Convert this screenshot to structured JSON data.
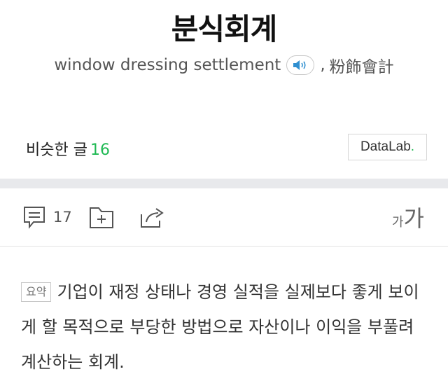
{
  "entry": {
    "title": "분식회계",
    "english": "window dressing settlement",
    "separator": ",",
    "hanja": "粉飾會計"
  },
  "icons": {
    "speaker": "speaker-icon",
    "comment": "comment-icon",
    "folder_add": "folder-add-icon",
    "share": "share-icon"
  },
  "similar": {
    "label": "비슷한 글",
    "count": "16"
  },
  "datalab": {
    "label": "DataLab",
    "dot": "."
  },
  "toolbar": {
    "comment_count": "17",
    "font_small": "가",
    "font_big": "가"
  },
  "summary": {
    "badge": "요약",
    "text": "기업이 재정 상태나 경영 실적을 실제보다 좋게 보이게 할 목적으로 부당한 방법으로 자산이나 이익을 부풀려 계산하는 회계."
  },
  "colors": {
    "accent_green": "#1fb953",
    "band_gray": "#e8e9ec"
  }
}
